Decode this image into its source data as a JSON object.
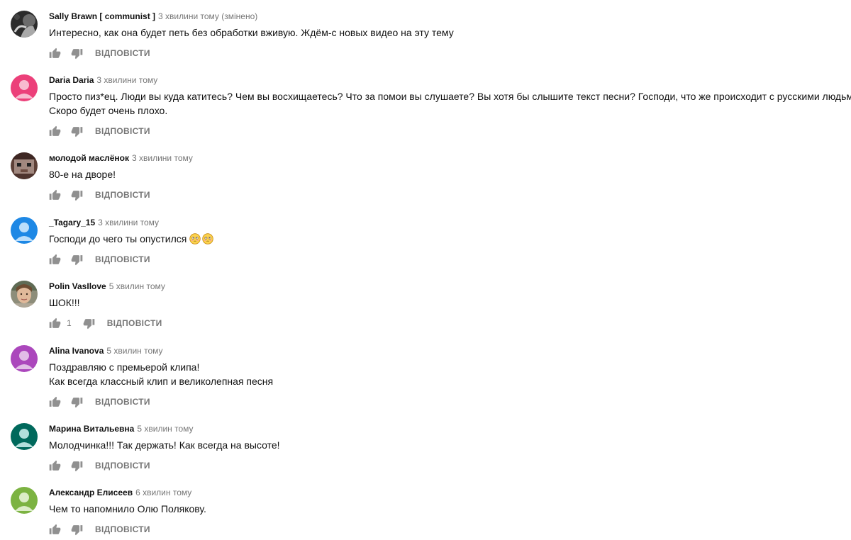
{
  "comments": [
    {
      "author": "Sally Brawn [ communist ]",
      "time": "3 хвилини тому",
      "edited": "(змінено)",
      "lines": [
        "Интересно, как она будет петь без обработки вживую. Ждём-с новых видео на эту тему"
      ],
      "likes": "",
      "avatar": "photo-dark"
    },
    {
      "author": "Daria Daria",
      "time": "3 хвилини тому",
      "edited": "",
      "lines": [
        "Просто пиз*ец. Люди вы куда катитесь? Чем вы восхищаетесь? Что за помои вы слушаете? Вы хотя бы слышите текст песни? Господи, что же происходит с русскими людьми....",
        "Скоро будет очень плохо."
      ],
      "likes": "",
      "avatar": "default-pink"
    },
    {
      "author": "молодой маслёнок",
      "time": "3 хвилини тому",
      "edited": "",
      "lines": [
        "80-е на дворе!"
      ],
      "likes": "",
      "avatar": "pixel-face"
    },
    {
      "author": "_Tagary_15",
      "time": "3 хвилини тому",
      "edited": "",
      "lines": [
        "Господи до чего ты опустился"
      ],
      "emoji_count": 2,
      "likes": "",
      "avatar": "default-blue"
    },
    {
      "author": "Polin VasIlove",
      "time": "5 хвилин тому",
      "edited": "",
      "lines": [
        "ШОК!!!"
      ],
      "likes": "1",
      "avatar": "photo-face"
    },
    {
      "author": "Alina Ivanova",
      "time": "5 хвилин тому",
      "edited": "",
      "lines": [
        "Поздравляю с премьерой клипа!",
        "Как всегда классный клип и великолепная песня"
      ],
      "likes": "",
      "avatar": "default-purple"
    },
    {
      "author": "Марина Витальевна",
      "time": "5 хвилин тому",
      "edited": "",
      "lines": [
        "Молодчинка!!! Так держать! Как всегда на высоте!"
      ],
      "likes": "",
      "avatar": "default-teal"
    },
    {
      "author": "Александр Елисеев",
      "time": "6 хвилин тому",
      "edited": "",
      "lines": [
        "Чем то напомнило Олю Полякову."
      ],
      "likes": "",
      "avatar": "default-green"
    }
  ],
  "reply_label": "ВІДПОВІСТИ",
  "icons": {
    "like": "thumb-up-icon",
    "dislike": "thumb-down-icon",
    "emoji": "flushed-face-emoji"
  },
  "colors": {
    "author": "#111111",
    "meta": "#767676",
    "icon": "#909090",
    "avatar_pink": "#ec407a",
    "avatar_blue": "#1e88e5",
    "avatar_purple": "#ab47bc",
    "avatar_teal": "#00695c",
    "avatar_green": "#7cb342"
  }
}
